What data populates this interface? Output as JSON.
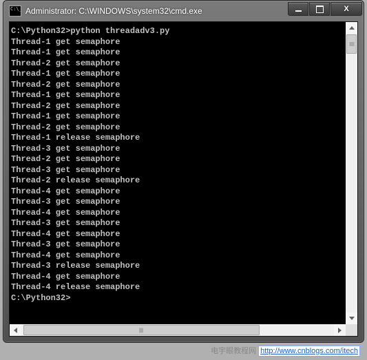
{
  "window": {
    "title": "Administrator: C:\\WINDOWS\\system32\\cmd.exe"
  },
  "console": {
    "prompt_path": "C:\\Python32>",
    "command": "python threadadv3.py",
    "lines": [
      "C:\\Python32>python threadadv3.py",
      "Thread-1 get semaphore",
      "Thread-1 get semaphore",
      "Thread-2 get semaphore",
      "Thread-1 get semaphore",
      "Thread-2 get semaphore",
      "Thread-1 get semaphore",
      "Thread-2 get semaphore",
      "Thread-1 get semaphore",
      "Thread-2 get semaphore",
      "Thread-1 release semaphore",
      "Thread-3 get semaphore",
      "Thread-2 get semaphore",
      "Thread-3 get semaphore",
      "Thread-2 release semaphore",
      "Thread-4 get semaphore",
      "Thread-3 get semaphore",
      "Thread-4 get semaphore",
      "Thread-3 get semaphore",
      "Thread-4 get semaphore",
      "Thread-3 get semaphore",
      "Thread-4 get semaphore",
      "Thread-3 release semaphore",
      "Thread-4 get semaphore",
      "Thread-4 release semaphore",
      "",
      "C:\\Python32>"
    ]
  },
  "scrollbar": {
    "v_thumb_top_pct": 4,
    "v_thumb_height_pct": 6,
    "h_thumb_left_pct": 4,
    "h_thumb_width_pct": 70
  },
  "watermark": {
    "prefix": "电宇眼教程网",
    "url": "http://www.cnblogs.com/itech"
  }
}
